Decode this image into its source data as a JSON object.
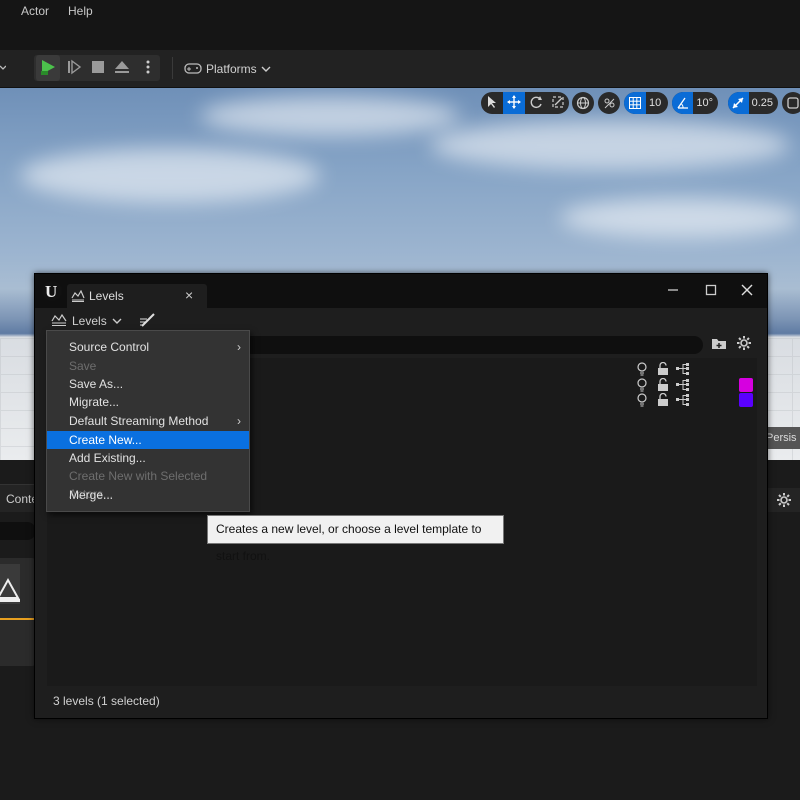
{
  "menubar": {
    "items": [
      "Actor",
      "Help"
    ]
  },
  "toolbar": {
    "platforms_label": "Platforms"
  },
  "viewport": {
    "grid_snap_value": "10",
    "rotation_snap_value": "10°",
    "scale_snap_value": "0.25",
    "overlay_text": "Persis"
  },
  "lower_panel": {
    "content_tab_label": "Conte"
  },
  "levels_window": {
    "tab_label": "Levels",
    "toolbar_levels_label": "Levels",
    "status_text": "3 levels (1 selected)",
    "level_rows": [
      {
        "color": ""
      },
      {
        "color": "#d600e0"
      },
      {
        "color": "#5a00ff"
      }
    ]
  },
  "context_menu": {
    "items": [
      {
        "label": "Source Control",
        "submenu": true,
        "enabled": true
      },
      {
        "label": "Save",
        "submenu": false,
        "enabled": false
      },
      {
        "label": "Save As...",
        "submenu": false,
        "enabled": true
      },
      {
        "label": "Migrate...",
        "submenu": false,
        "enabled": true
      },
      {
        "label": "Default Streaming Method",
        "submenu": true,
        "enabled": true
      },
      {
        "label": "Create New...",
        "submenu": false,
        "enabled": true,
        "highlighted": true
      },
      {
        "label": "Add Existing...",
        "submenu": false,
        "enabled": true
      },
      {
        "label": "Create New with Selected Actors...",
        "submenu": false,
        "enabled": false
      },
      {
        "label": "Merge...",
        "submenu": false,
        "enabled": true
      }
    ]
  },
  "tooltip": {
    "text": "Creates a new level, or choose a level template to start from."
  },
  "colors": {
    "accent": "#0a70e0",
    "play_green": "#4cc24c"
  }
}
